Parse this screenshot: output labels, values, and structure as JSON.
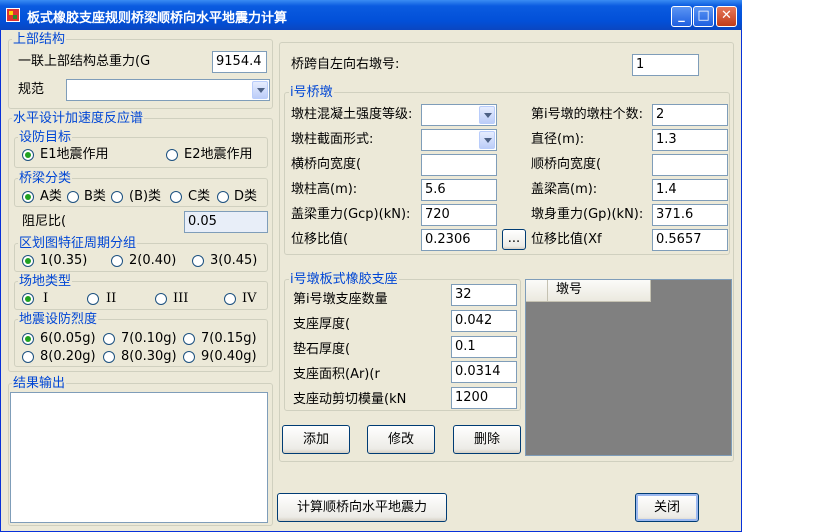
{
  "window": {
    "title": "板式橡胶支座规则桥梁顺桥向水平地震力计算",
    "minimize": "_",
    "maximize": "□",
    "close": "✕"
  },
  "upper": {
    "title": "上部结构",
    "weight_label": "一联上部结构总重力(G",
    "weight_value": "9154.4",
    "spec_label": "规范",
    "spec_value": ""
  },
  "spectrum": {
    "title": "水平设计加速度反应谱",
    "target": {
      "title": "设防目标",
      "options": [
        "E1地震作用",
        "E2地震作用"
      ],
      "selected": 0
    },
    "bridge_class": {
      "title": "桥梁分类",
      "options": [
        "A类",
        "B类",
        "(B)类",
        "C类",
        "D类"
      ],
      "selected": 0
    },
    "damping_label": "阻尼比(",
    "damping_value": "0.05",
    "period": {
      "title": "区划图特征周期分组",
      "options": [
        "1(0.35)",
        "2(0.40)",
        "3(0.45)"
      ],
      "selected": 0
    },
    "site": {
      "title": "场地类型",
      "options": [
        "I",
        "II",
        "III",
        "IV"
      ],
      "selected": 0
    },
    "intensity": {
      "title": "地震设防烈度",
      "options": [
        "6(0.05g)",
        "7(0.10g)",
        "7(0.15g)",
        "8(0.20g)",
        "8(0.30g)",
        "9(0.40g)"
      ],
      "selected": 0
    }
  },
  "result": {
    "title": "结果输出",
    "text": ""
  },
  "pier_no": {
    "label": "桥跨自左向右墩号:",
    "value": "1"
  },
  "pier": {
    "title": "i号桥墩",
    "concrete_grade_label": "墩柱混凝土强度等级:",
    "concrete_grade_value": "",
    "column_count_label": "第i号墩的墩柱个数:",
    "column_count_value": "2",
    "section_label": "墩柱截面形式:",
    "section_value": "",
    "diameter_label": "直径(m):",
    "diameter_value": "1.3",
    "transverse_width_label": "横桥向宽度(",
    "transverse_width_value": "",
    "longitudinal_width_label": "顺桥向宽度(",
    "longitudinal_width_value": "",
    "column_height_label": "墩柱高(m):",
    "column_height_value": "5.6",
    "cap_height_label": "盖梁高(m):",
    "cap_height_value": "1.4",
    "cap_weight_label": "盖梁重力(Gcp)(kN):",
    "cap_weight_value": "720",
    "pier_weight_label": "墩身重力(Gp)(kN):",
    "pier_weight_value": "371.6",
    "disp_ratio_label": "位移比值(",
    "disp_ratio_value": "0.2306",
    "disp_ratio_button": "...",
    "disp_ratio_xf_label": "位移比值(Xf",
    "disp_ratio_xf_value": "0.5657"
  },
  "bearing": {
    "title": "i号墩板式橡胶支座",
    "count_label": "第i号墩支座数量",
    "count_value": "32",
    "thickness_label": "支座厚度(",
    "thickness_value": "0.042",
    "pad_thickness_label": "垫石厚度(",
    "pad_thickness_value": "0.1",
    "area_label": "支座面积(Ar)(r",
    "area_value": "0.0314",
    "shear_modulus_label": "支座动剪切模量(kN",
    "shear_modulus_value": "1200"
  },
  "grid": {
    "column_header": "墩号"
  },
  "buttons": {
    "add": "添加",
    "modify": "修改",
    "delete": "删除",
    "calculate": "计算顺桥向水平地震力",
    "close": "关闭"
  }
}
